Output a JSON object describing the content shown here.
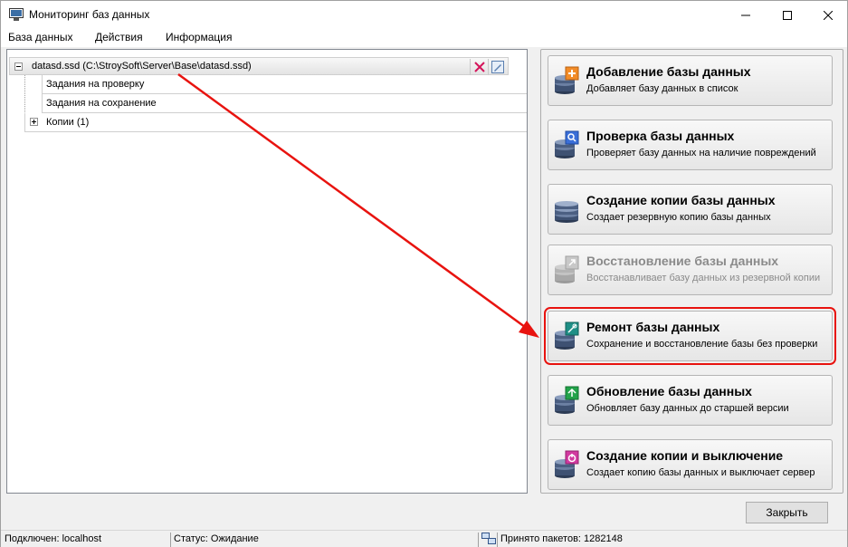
{
  "window": {
    "title": "Мониторинг баз данных",
    "icon": "database-monitor-icon"
  },
  "menu": [
    "База данных",
    "Действия",
    "Информация"
  ],
  "tree": {
    "root": {
      "label": "datasd.ssd (C:\\StroySoft\\Server\\Base\\datasd.ssd)"
    },
    "children": [
      {
        "label": "Задания на проверку"
      },
      {
        "label": "Задания на сохранение"
      },
      {
        "label": "Копии (1)"
      }
    ]
  },
  "actions": [
    {
      "title": "Добавление базы данных",
      "description": "Добавляет базу данных в список",
      "icon": "add-database-icon",
      "badge_color": "#f28c28",
      "enabled": true
    },
    {
      "title": "Проверка базы данных",
      "description": "Проверяет базу данных на наличие повреждений",
      "icon": "check-database-icon",
      "badge_color": "#3a6fd8",
      "enabled": true
    },
    {
      "title": "Создание копии базы данных",
      "description": "Создает резервную копию базы данных",
      "icon": "copy-database-icon",
      "badge_color": "",
      "enabled": true
    },
    {
      "title": "Восстановление базы данных",
      "description": "Восстанавливает базу данных из резервной копии",
      "icon": "restore-database-icon",
      "badge_color": "#b0b0b0",
      "enabled": false
    },
    {
      "title": "Ремонт базы данных",
      "description": "Сохранение и восстановление базы без проверки",
      "icon": "repair-database-icon",
      "badge_color": "#1f8f86",
      "enabled": true,
      "highlighted": true
    },
    {
      "title": "Обновление базы данных",
      "description": "Обновляет базу данных до старшей версии",
      "icon": "update-database-icon",
      "badge_color": "#22a34a",
      "enabled": true
    },
    {
      "title": "Создание копии и выключение",
      "description": "Создает копию базы данных и выключает сервер",
      "icon": "copy-shutdown-icon",
      "badge_color": "#d23aa0",
      "enabled": true
    }
  ],
  "close_label": "Закрыть",
  "status": {
    "connection": "Подключен: localhost",
    "state": "Статус: Ожидание",
    "packets": "Принято пакетов: 1282148"
  },
  "colors": {
    "annotation": "#e8130f"
  }
}
